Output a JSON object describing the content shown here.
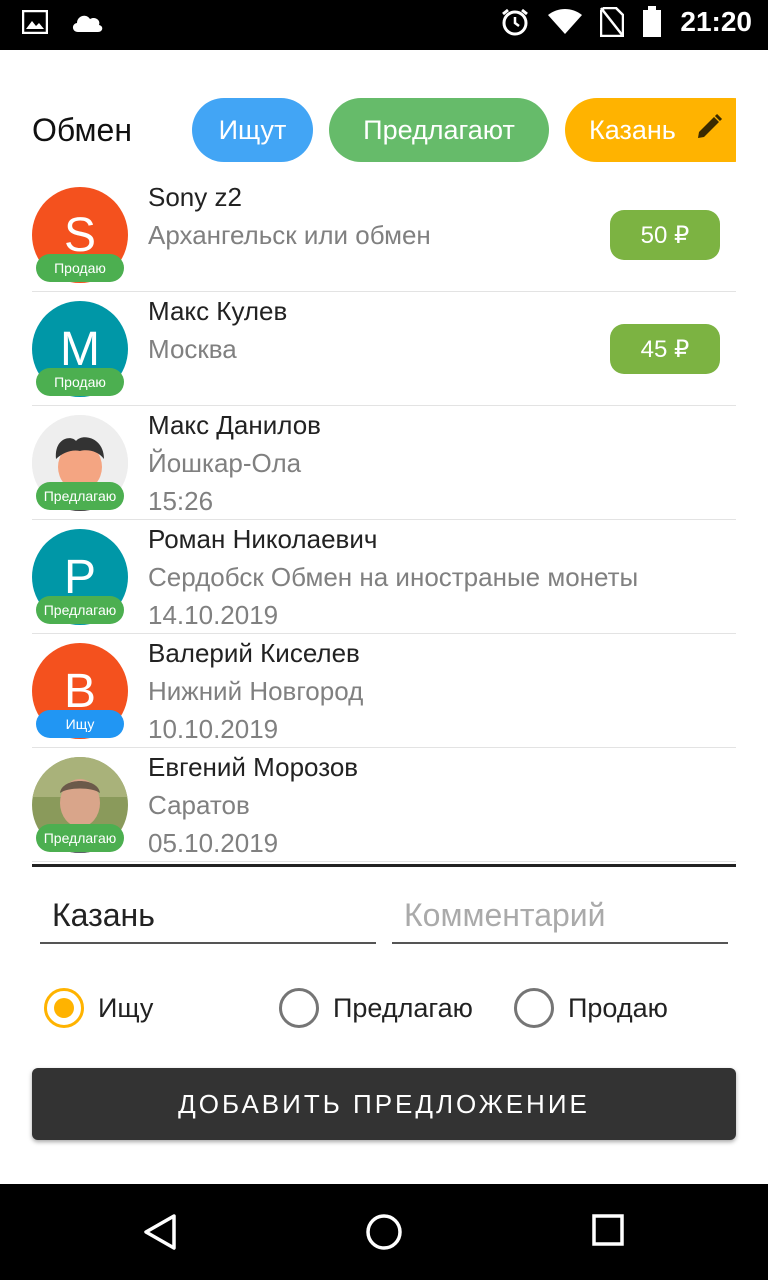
{
  "status_bar": {
    "time": "21:20",
    "icons": [
      "image-icon",
      "cloud-icon",
      "alarm-icon",
      "wifi-icon",
      "no-sim-icon",
      "battery-icon"
    ]
  },
  "header": {
    "title": "Обмен",
    "chips": {
      "seek": "Ищут",
      "offer": "Предлагают",
      "city": "Казань"
    }
  },
  "colors": {
    "seek_blue": "#42a5f5",
    "offer_green": "#66bb6a",
    "city_amber": "#ffb300",
    "price_green": "#7cb342",
    "button_dark": "#333333"
  },
  "listings": [
    {
      "avatar_letter": "S",
      "badge": "Продаю",
      "name": "Sony z2",
      "subtitle": "Архангельск или обмен",
      "date": "",
      "price": "50 ₽"
    },
    {
      "avatar_letter": "M",
      "badge": "Продаю",
      "name": "Макс Кулев",
      "subtitle": "Москва",
      "date": "",
      "price": "45 ₽"
    },
    {
      "avatar_letter": "",
      "badge": "Предлагаю",
      "name": "Макс Данилов",
      "subtitle": "Йошкар-Ола",
      "date": "15:26",
      "price": ""
    },
    {
      "avatar_letter": "P",
      "badge": "Предлагаю",
      "name": "Роман Николаевич",
      "subtitle": "Сердобск Обмен на иностраные монеты",
      "date": "14.10.2019",
      "price": ""
    },
    {
      "avatar_letter": "B",
      "badge": "Ищу",
      "name": "Валерий Киселев",
      "subtitle": "Нижний Новгород",
      "date": "10.10.2019",
      "price": ""
    },
    {
      "avatar_letter": "",
      "badge": "Предлагаю",
      "name": "Евгений Морозов",
      "subtitle": "Саратов",
      "date": "05.10.2019",
      "price": ""
    }
  ],
  "form": {
    "city_value": "Казань",
    "comment_placeholder": "Комментарий",
    "radio_options": [
      "Ищу",
      "Предлагаю",
      "Продаю"
    ],
    "selected_option": "Ищу",
    "submit_label": "ДОБАВИТЬ ПРЕДЛОЖЕНИЕ"
  },
  "nav_bar": {
    "icons": [
      "back-icon",
      "home-icon",
      "recents-icon"
    ]
  }
}
